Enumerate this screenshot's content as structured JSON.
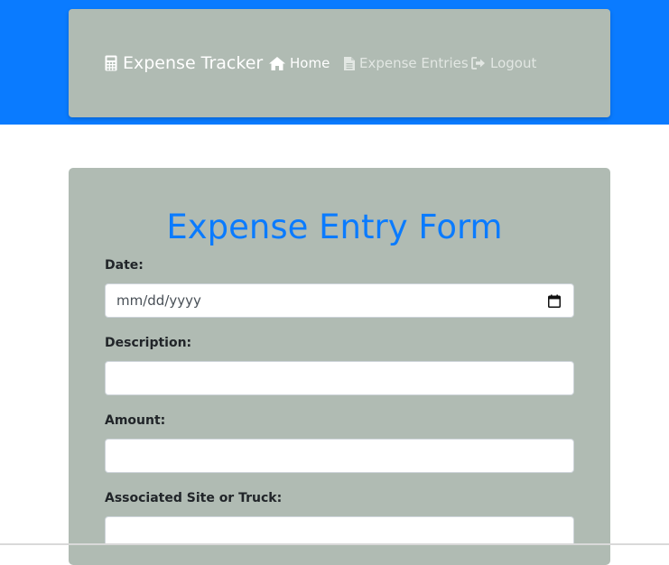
{
  "navbar": {
    "brand": "Expense Tracker",
    "brand_icon": "calculator-icon",
    "links": [
      {
        "label": "Home",
        "icon": "home-icon",
        "active": true
      },
      {
        "label": "Expense Entries",
        "icon": "document-icon",
        "active": false
      },
      {
        "label": "Logout",
        "icon": "logout-icon",
        "active": false
      }
    ]
  },
  "form": {
    "title": "Expense Entry Form",
    "fields": [
      {
        "label": "Date:",
        "placeholder": "mm/dd/yyyy",
        "value": ""
      },
      {
        "label": "Description:",
        "value": ""
      },
      {
        "label": "Amount:",
        "value": ""
      },
      {
        "label": "Associated Site or Truck:",
        "value": ""
      }
    ]
  },
  "colors": {
    "primary": "#0a7bff",
    "panel": "#b0bbb3"
  }
}
